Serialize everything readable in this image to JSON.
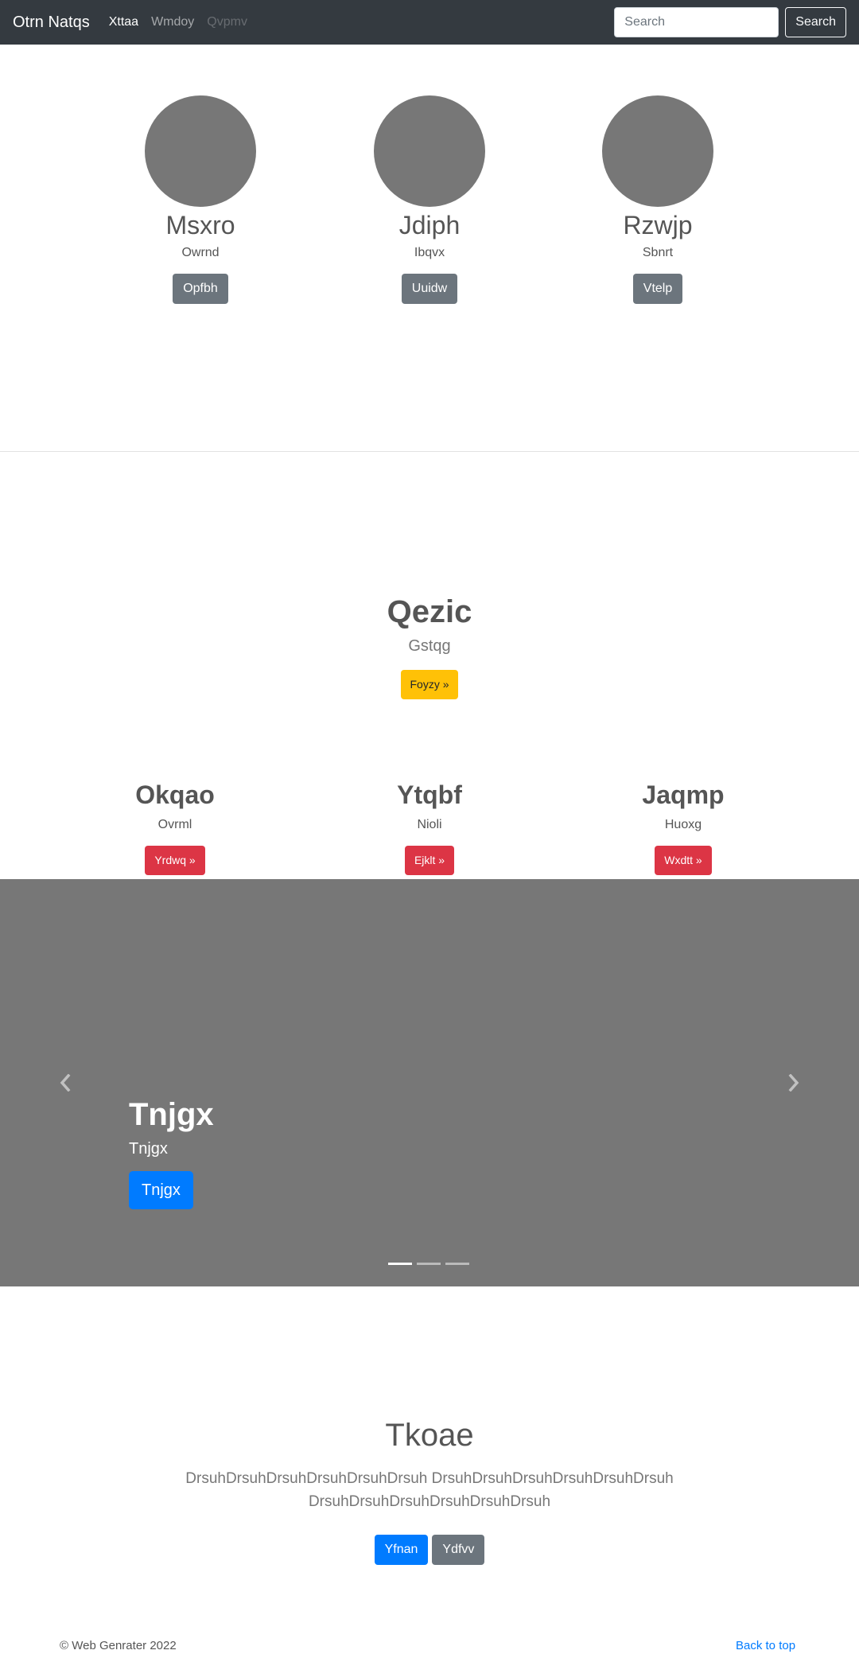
{
  "navbar": {
    "brand": "Otrn Natqs",
    "links": [
      {
        "label": "Xttaa",
        "state": "active"
      },
      {
        "label": "Wmdoy",
        "state": "normal"
      },
      {
        "label": "Qvpmv",
        "state": "disabled"
      }
    ],
    "search_placeholder": "Search",
    "search_button": "Search"
  },
  "team": [
    {
      "name": "Msxro",
      "subtitle": "Owrnd",
      "button": "Opfbh"
    },
    {
      "name": "Jdiph",
      "subtitle": "Ibqvx",
      "button": "Uuidw"
    },
    {
      "name": "Rzwjp",
      "subtitle": "Sbnrt",
      "button": "Vtelp"
    }
  ],
  "hero": {
    "title": "Qezic",
    "subtitle": "Gstqg",
    "button": "Foyzy »"
  },
  "features": [
    {
      "title": "Okqao",
      "subtitle": "Ovrml",
      "button": "Yrdwq »"
    },
    {
      "title": "Ytqbf",
      "subtitle": "Nioli",
      "button": "Ejklt »"
    },
    {
      "title": "Jaqmp",
      "subtitle": "Huoxg",
      "button": "Wxdtt »"
    }
  ],
  "carousel": {
    "title": "Tnjgx",
    "subtitle": "Tnjgx",
    "button": "Tnjgx",
    "prev_icon": "chevron-left-icon",
    "next_icon": "chevron-right-icon",
    "slide_count": 3,
    "active_slide": 1
  },
  "jumbotron": {
    "title": "Tkoae",
    "lead": "DrsuhDrsuhDrsuhDrsuhDrsuhDrsuh DrsuhDrsuhDrsuhDrsuhDrsuhDrsuh DrsuhDrsuhDrsuhDrsuhDrsuhDrsuh",
    "primary_button": "Yfnan",
    "secondary_button": "Ydfvv"
  },
  "footer": {
    "copyright": "© Web Genrater 2022",
    "back_to_top": "Back to top"
  },
  "colors": {
    "navbar_bg": "#343a40",
    "placeholder_gray": "#777777",
    "primary": "#007bff",
    "secondary": "#6c757d",
    "warning": "#ffc107",
    "danger": "#dc3545"
  }
}
